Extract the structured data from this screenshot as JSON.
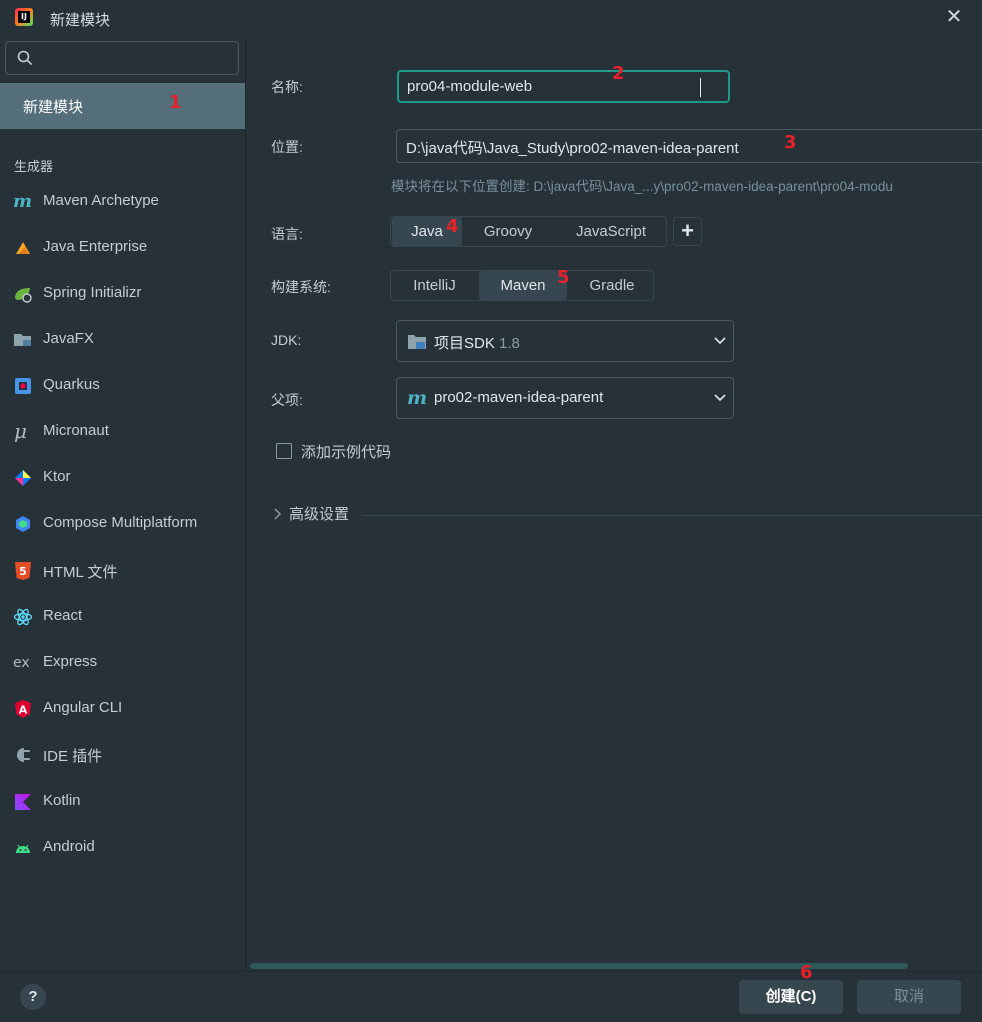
{
  "window": {
    "title": "新建模块",
    "close_icon": "close-icon"
  },
  "sidebar": {
    "search_placeholder": "",
    "selected_item": "新建模块",
    "section_label": "生成器",
    "generators": [
      {
        "label": "Maven Archetype",
        "icon": "maven-icon"
      },
      {
        "label": "Java Enterprise",
        "icon": "java-enterprise-icon"
      },
      {
        "label": "Spring Initializr",
        "icon": "spring-icon"
      },
      {
        "label": "JavaFX",
        "icon": "javafx-icon"
      },
      {
        "label": "Quarkus",
        "icon": "quarkus-icon"
      },
      {
        "label": "Micronaut",
        "icon": "micronaut-icon"
      },
      {
        "label": "Ktor",
        "icon": "ktor-icon"
      },
      {
        "label": "Compose Multiplatform",
        "icon": "compose-icon"
      },
      {
        "label": "HTML 文件",
        "icon": "html5-icon"
      },
      {
        "label": "React",
        "icon": "react-icon"
      },
      {
        "label": "Express",
        "icon": "express-icon"
      },
      {
        "label": "Angular CLI",
        "icon": "angular-icon"
      },
      {
        "label": "IDE 插件",
        "icon": "plugin-icon"
      },
      {
        "label": "Kotlin",
        "icon": "kotlin-icon"
      },
      {
        "label": "Android",
        "icon": "android-icon"
      }
    ]
  },
  "form": {
    "name_label": "名称:",
    "name_value": "pro04-module-web",
    "location_label": "位置:",
    "location_value": "D:\\java代码\\Java_Study\\pro02-maven-idea-parent",
    "location_hint": "模块将在以下位置创建: D:\\java代码\\Java_...y\\pro02-maven-idea-parent\\pro04-modu",
    "language_label": "语言:",
    "languages": [
      "Java",
      "Groovy",
      "JavaScript"
    ],
    "language_selected": "Java",
    "add_language": "+",
    "build_label": "构建系统:",
    "build_systems": [
      "IntelliJ",
      "Maven",
      "Gradle"
    ],
    "build_selected": "Maven",
    "jdk_label": "JDK:",
    "jdk_value": "项目SDK",
    "jdk_version": "1.8",
    "parent_label": "父项:",
    "parent_value": "pro02-maven-idea-parent",
    "sample_code_label": "添加示例代码",
    "sample_code_checked": false,
    "advanced_label": "高级设置"
  },
  "footer": {
    "help": "?",
    "create": "创建(C)",
    "cancel": "取消"
  },
  "annotations": [
    "1",
    "2",
    "3",
    "4",
    "5",
    "6"
  ],
  "colors": {
    "background": "#263238",
    "selected": "#546e7a",
    "focus_border": "#1e9a8a",
    "annotation": "#e8202a"
  }
}
